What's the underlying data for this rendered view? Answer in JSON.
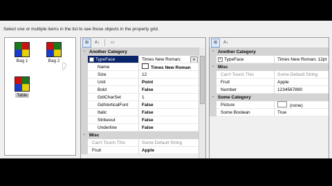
{
  "instruction": "Select one or multiple items in the list to see those objects in the property grid.",
  "list_items": [
    {
      "label": "Bag 1",
      "colors": [
        "#1a7a1a",
        "#cc1111",
        "#1a3ccc",
        "#e6d200"
      ],
      "selected": false
    },
    {
      "label": "Bag 2",
      "colors": [
        "#cc1111",
        "#1a7a1a",
        "#1a3ccc",
        "#e6d200"
      ],
      "selected": false
    },
    {
      "label": "Table",
      "colors": [
        "#cc1111",
        "#1a7a1a",
        "#1a3ccc",
        "#e6d200"
      ],
      "selected": true
    }
  ],
  "left_grid": {
    "rows": [
      {
        "kind": "cat",
        "name": "Another Category"
      },
      {
        "kind": "prop",
        "name": "TypeFace",
        "value": "Times New Roman;",
        "selected": true,
        "expand": "-"
      },
      {
        "kind": "sub",
        "name": "Name",
        "value": "Times New Roman",
        "bold": true,
        "icon": "font-icon"
      },
      {
        "kind": "sub",
        "name": "Size",
        "value": "12"
      },
      {
        "kind": "sub",
        "name": "Unit",
        "value": "Point",
        "bold": true
      },
      {
        "kind": "sub",
        "name": "Bold",
        "value": "False",
        "bold": true
      },
      {
        "kind": "sub",
        "name": "GdiCharSet",
        "value": "1"
      },
      {
        "kind": "sub",
        "name": "GdiVerticalFont",
        "value": "False",
        "bold": true
      },
      {
        "kind": "sub",
        "name": "Italic",
        "value": "False",
        "bold": true
      },
      {
        "kind": "sub",
        "name": "Strikeout",
        "value": "False",
        "bold": true
      },
      {
        "kind": "sub",
        "name": "Underline",
        "value": "False",
        "bold": true
      },
      {
        "kind": "cat",
        "name": "Misc"
      },
      {
        "kind": "ro",
        "name": "Can't Touch This",
        "value": "Some Default String"
      },
      {
        "kind": "prop",
        "name": "Fruit",
        "value": "Apple",
        "bold": true
      }
    ]
  },
  "right_grid": {
    "rows": [
      {
        "kind": "cat",
        "name": "Another Category"
      },
      {
        "kind": "prop",
        "name": "TypeFace",
        "value": "Times New Roman; 12pt",
        "expand": "+"
      },
      {
        "kind": "cat",
        "name": "Misc"
      },
      {
        "kind": "ro",
        "name": "Can't Touch This",
        "value": "Some Default String"
      },
      {
        "kind": "prop",
        "name": "Fruit",
        "value": "Apple"
      },
      {
        "kind": "prop",
        "name": "Number",
        "value": "1234567890"
      },
      {
        "kind": "cat",
        "name": "Some Category"
      },
      {
        "kind": "prop",
        "name": "Picture",
        "value": "(none)",
        "swatch": true
      },
      {
        "kind": "prop",
        "name": "Some Boolean",
        "value": "True"
      }
    ]
  },
  "toolbar": {
    "categorized": "⊞",
    "alphabetical": "A↓",
    "pages": "▭"
  },
  "icons": {
    "collapse": "-",
    "expand": "+",
    "dropdown": "▾"
  }
}
